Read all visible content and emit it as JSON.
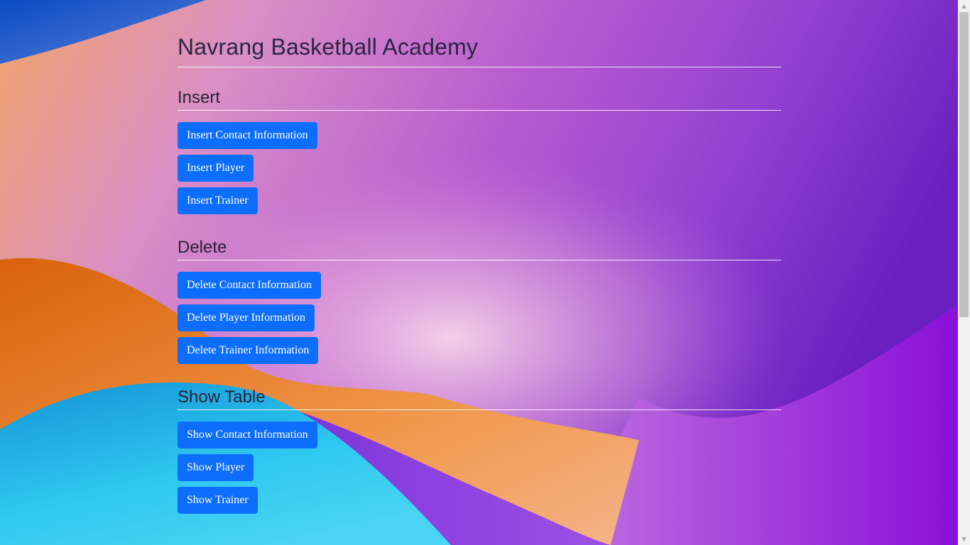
{
  "page": {
    "title": "Navrang Basketball Academy"
  },
  "sections": [
    {
      "heading": "Insert",
      "buttons": [
        "Insert Contact Information",
        "Insert Player",
        "Insert Trainer"
      ]
    },
    {
      "heading": "Delete",
      "buttons": [
        "Delete Contact Information",
        "Delete Player Information",
        "Delete Trainer Information"
      ]
    },
    {
      "heading": "Show Table",
      "buttons": [
        "Show Contact Information",
        "Show Player",
        "Show Trainer"
      ]
    }
  ],
  "colors": {
    "button": "#0d6efd",
    "button_text": "#ffffff",
    "heading": "#2c2346"
  },
  "scrollbar": {
    "up_icon": "chevron-up-icon",
    "down_icon": "chevron-down-icon"
  }
}
